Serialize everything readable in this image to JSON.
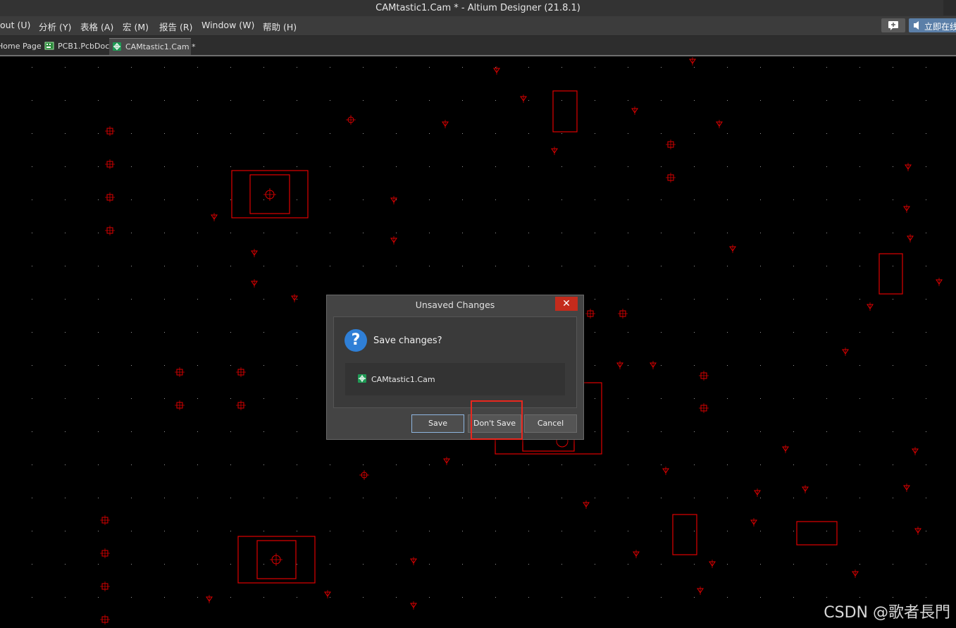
{
  "window": {
    "title": "CAMtastic1.Cam * - Altium Designer (21.8.1)"
  },
  "menubar": {
    "items": [
      "out (U)",
      "分析 (Y)",
      "表格 (A)",
      "宏 (M)",
      "报告 (R)",
      "Window (W)",
      "帮助 (H)"
    ],
    "online_label": "立即在线"
  },
  "tabs": [
    {
      "label": "Home Page",
      "icon": "home-page-icon"
    },
    {
      "label": "PCB1.PcbDoc",
      "icon": "pcb-document-icon"
    },
    {
      "label": "CAMtastic1.Cam *",
      "icon": "cam-document-icon",
      "active": true
    }
  ],
  "dialog": {
    "title": "Unsaved Changes",
    "question": "Save changes?",
    "file_name": "CAMtastic1.Cam",
    "buttons": {
      "save": "Save",
      "dont_save": "Don't Save",
      "cancel": "Cancel"
    }
  },
  "watermark": "CSDN @歌者長門",
  "colors": {
    "canvas_background": "#000000",
    "cad_red": "#e00000",
    "close_button": "#c42b1c",
    "question_icon": "#2f7fd6",
    "highlight_box": "#e8271e"
  }
}
